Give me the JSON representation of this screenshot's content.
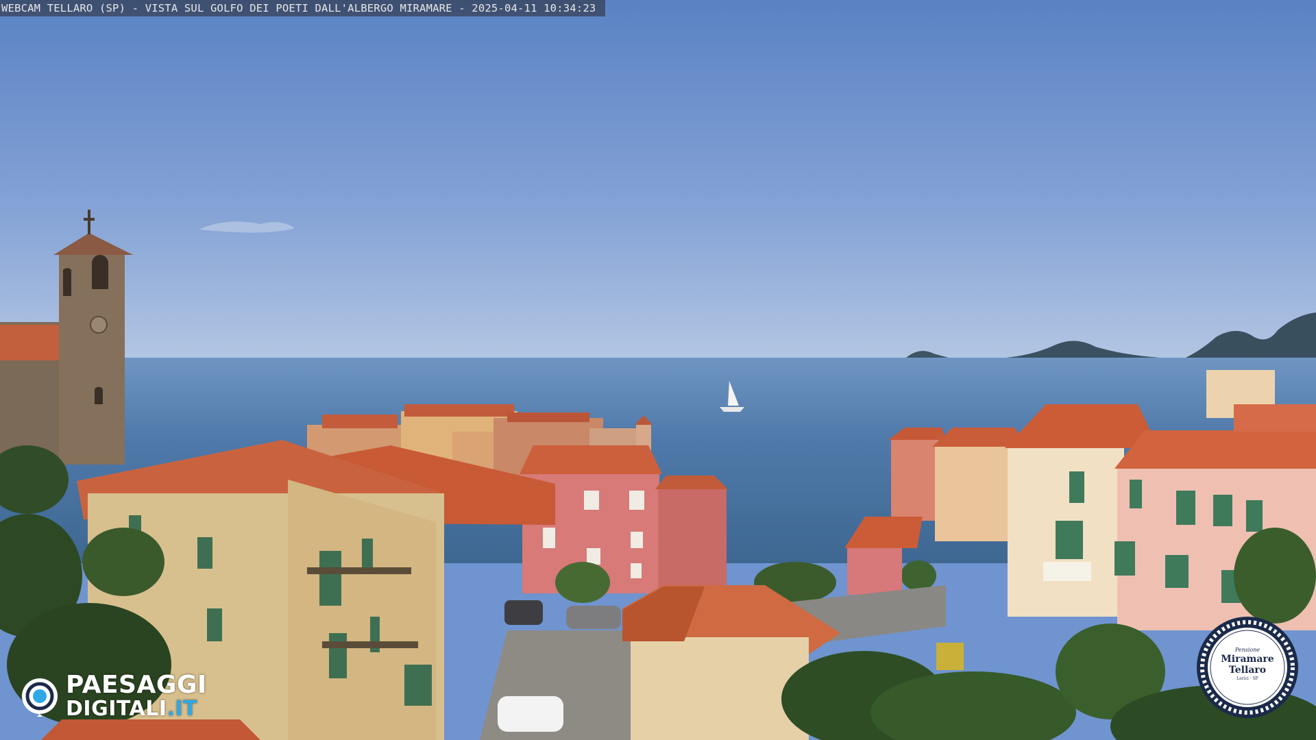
{
  "webcam": {
    "caption": "WEBCAM TELLARO (SP) - VISTA SUL GOLFO DEI POETI DALL'ALBERGO MIRAMARE - 2025-04-11 10:34:23"
  },
  "watermark": {
    "brand_line1": "PAESAGGI",
    "brand_line2_main": "DIGITALI",
    "brand_line2_suffix": ".IT",
    "icon": "eye-icon"
  },
  "badge": {
    "pre": "Pensione",
    "name_line1": "Miramare",
    "name_line2": "Tellaro",
    "sub": "Lerici · SP"
  },
  "colors": {
    "sky_top": "#5f86c6",
    "sky_horizon": "#a9bfe0",
    "sea": "#4a74a6",
    "roof": "#c9603e",
    "badge_ring": "#1b2a4a"
  }
}
